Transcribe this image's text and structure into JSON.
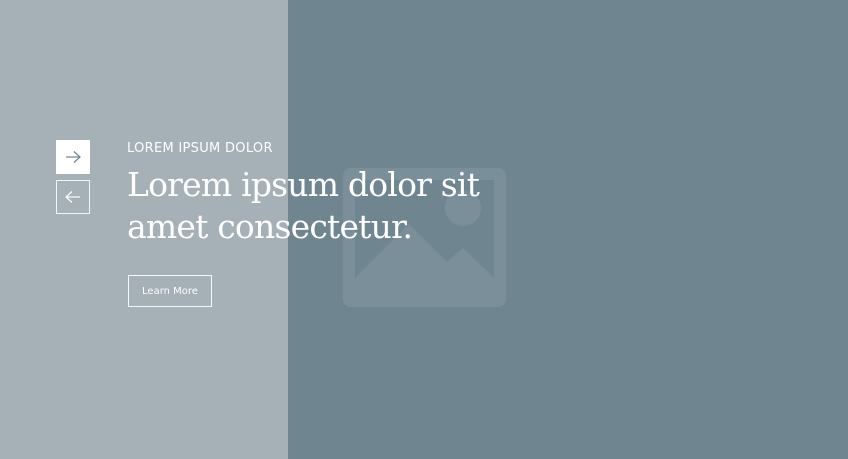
{
  "slide": {
    "eyebrow": "LOREM IPSUM DOLOR",
    "headline_line1": "Lorem ipsum dolor sit",
    "headline_line2": "amet consectetur.",
    "cta_label": "Learn More"
  },
  "navigation": {
    "next_icon": "arrow-right-icon",
    "prev_icon": "arrow-left-icon"
  },
  "media": {
    "icon": "image-placeholder-icon"
  },
  "colors": {
    "left_panel": "#a5b0b7",
    "right_panel": "#6f8590",
    "text": "#ffffff"
  }
}
